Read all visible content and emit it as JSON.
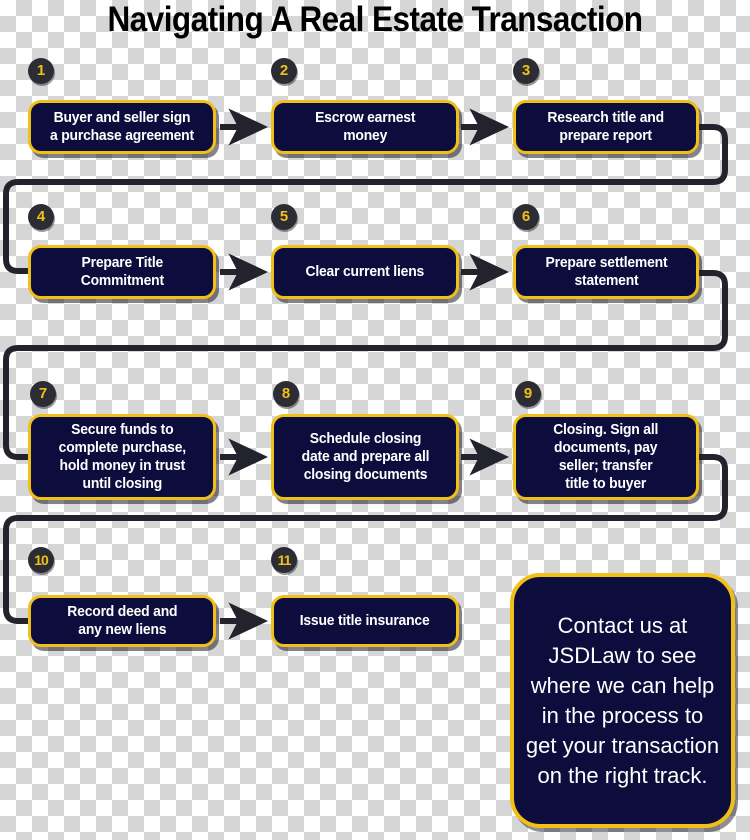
{
  "title": "Navigating A Real Estate Transaction",
  "theme": {
    "box_fill": "#0d0d3d",
    "box_border": "#f0c018",
    "badge_fill": "#2c2c34",
    "badge_text": "#f0c018",
    "connector": "#23232e",
    "box_text": "#ffffff",
    "title_text": "#000000"
  },
  "steps": [
    {
      "number": "1",
      "label": "Buyer and seller sign\na purchase agreement"
    },
    {
      "number": "2",
      "label": "Escrow earnest\nmoney"
    },
    {
      "number": "3",
      "label": "Research title and\nprepare report"
    },
    {
      "number": "4",
      "label": "Prepare Title\nCommitment"
    },
    {
      "number": "5",
      "label": "Clear current liens"
    },
    {
      "number": "6",
      "label": "Prepare settlement\nstatement"
    },
    {
      "number": "7",
      "label": "Secure funds to\ncomplete purchase,\nhold money in trust\nuntil closing"
    },
    {
      "number": "8",
      "label": "Schedule closing\ndate and prepare all\nclosing documents"
    },
    {
      "number": "9",
      "label": "Closing. Sign all\ndocuments, pay\nseller; transfer\ntitle to buyer"
    },
    {
      "number": "10",
      "label": "Record deed and\nany new liens"
    },
    {
      "number": "11",
      "label": "Issue title insurance"
    }
  ],
  "contact": {
    "text": "Contact us at JSDLaw to see where we can help in the process to get your transaction on the right track."
  }
}
